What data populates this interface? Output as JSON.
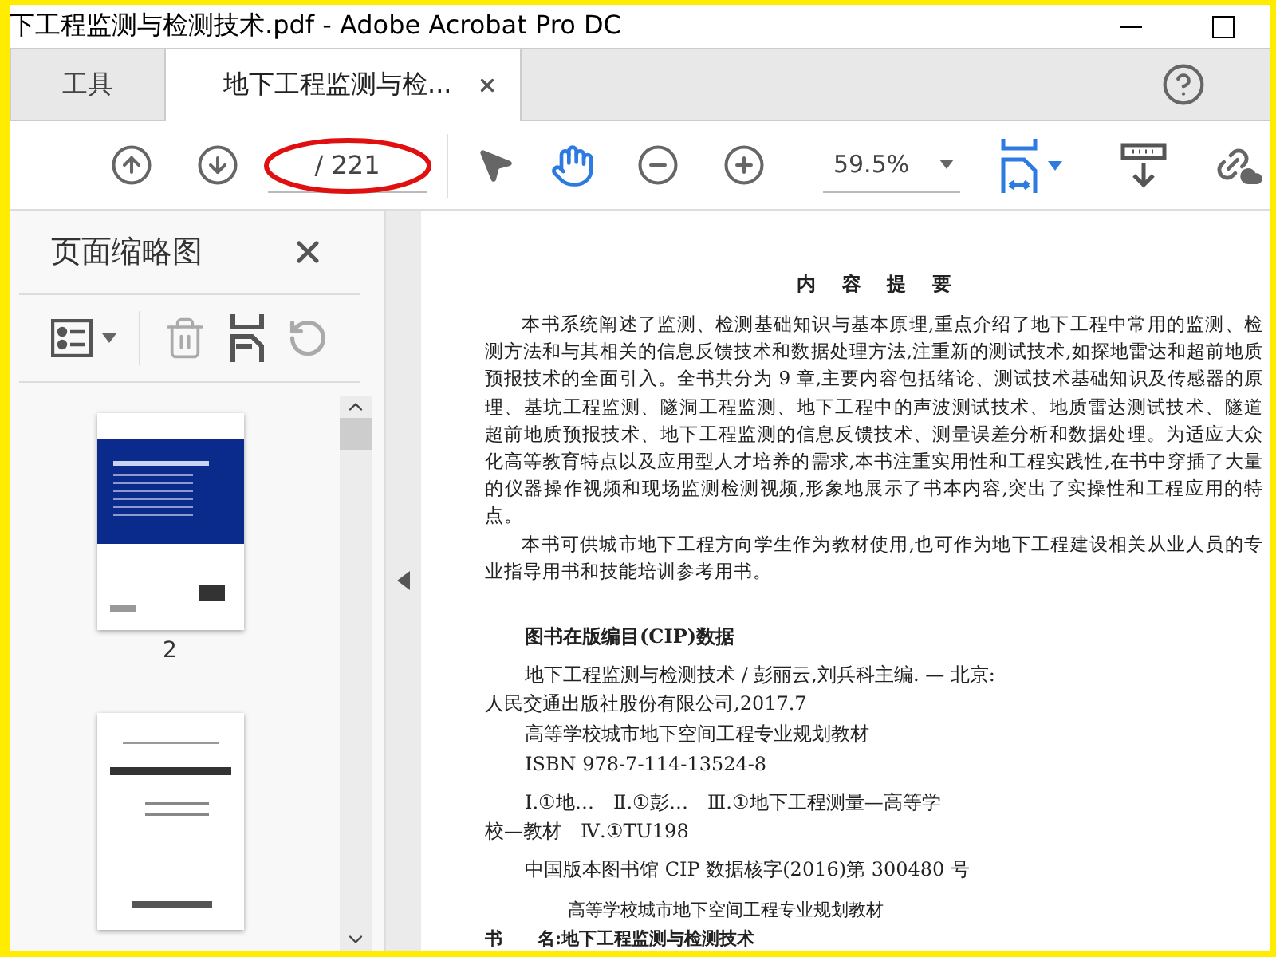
{
  "window": {
    "title": "下工程监测与检测技术.pdf - Adobe Acrobat Pro DC"
  },
  "tabs": [
    {
      "label": "工具",
      "selected": false
    },
    {
      "label": "地下工程监测与检...",
      "selected": true
    }
  ],
  "toolbar": {
    "page_total": "/ 221",
    "zoom": "59.5%"
  },
  "sidebar": {
    "title": "页面缩略图",
    "thumbnails": [
      {
        "label": "2",
        "kind": "back-cover"
      },
      {
        "kind": "title-page"
      }
    ]
  },
  "document": {
    "heading": "内 容 提 要",
    "paragraphs": [
      "本书系统阐述了监测、检测基础知识与基本原理,重点介绍了地下工程中常用的监测、检测方法和与其相关的信息反馈技术和数据处理方法,注重新的测试技术,如探地雷达和超前地质预报技术的全面引入。全书共分为 9 章,主要内容包括绪论、测试技术基础知识及传感器的原理、基坑工程监测、隧洞工程监测、地下工程中的声波测试技术、地质雷达测试技术、隧道超前地质预报技术、地下工程监测的信息反馈技术、测量误差分析和数据处理。为适应大众化高等教育特点以及应用型人才培养的需求,本书注重实用性和工程实践性,在书中穿插了大量的仪器操作视频和现场监测检测视频,形象地展示了书本内容,突出了实操性和工程应用的特点。",
      "本书可供城市地下工程方向学生作为教材使用,也可作为地下工程建设相关从业人员的专业指导用书和技能培训参考用书。"
    ],
    "cip_heading": "图书在版编目(CIP)数据",
    "cip_lines": [
      {
        "text": "地下工程监测与检测技术 / 彭丽云,刘兵科主编. — 北京:",
        "indent": true
      },
      {
        "text": "人民交通出版社股份有限公司,2017.7",
        "indent": false
      },
      {
        "text": "高等学校城市地下空间工程专业规划教材",
        "indent": true
      },
      {
        "text": "ISBN 978-7-114-13524-8",
        "indent": true
      },
      {
        "text": "Ⅰ.①地…　Ⅱ.①彭…　Ⅲ.①地下工程测量—高等学",
        "indent": true
      },
      {
        "text": "校—教材　Ⅳ.①TU198",
        "indent": false
      },
      {
        "text": "中国版本图书馆 CIP 数据核字(2016)第 300480 号",
        "indent": true
      }
    ],
    "series": "高等学校城市地下空间工程专业规划教材",
    "book_label": "书　　名:",
    "book_title": "地下工程监测与检测技术"
  }
}
